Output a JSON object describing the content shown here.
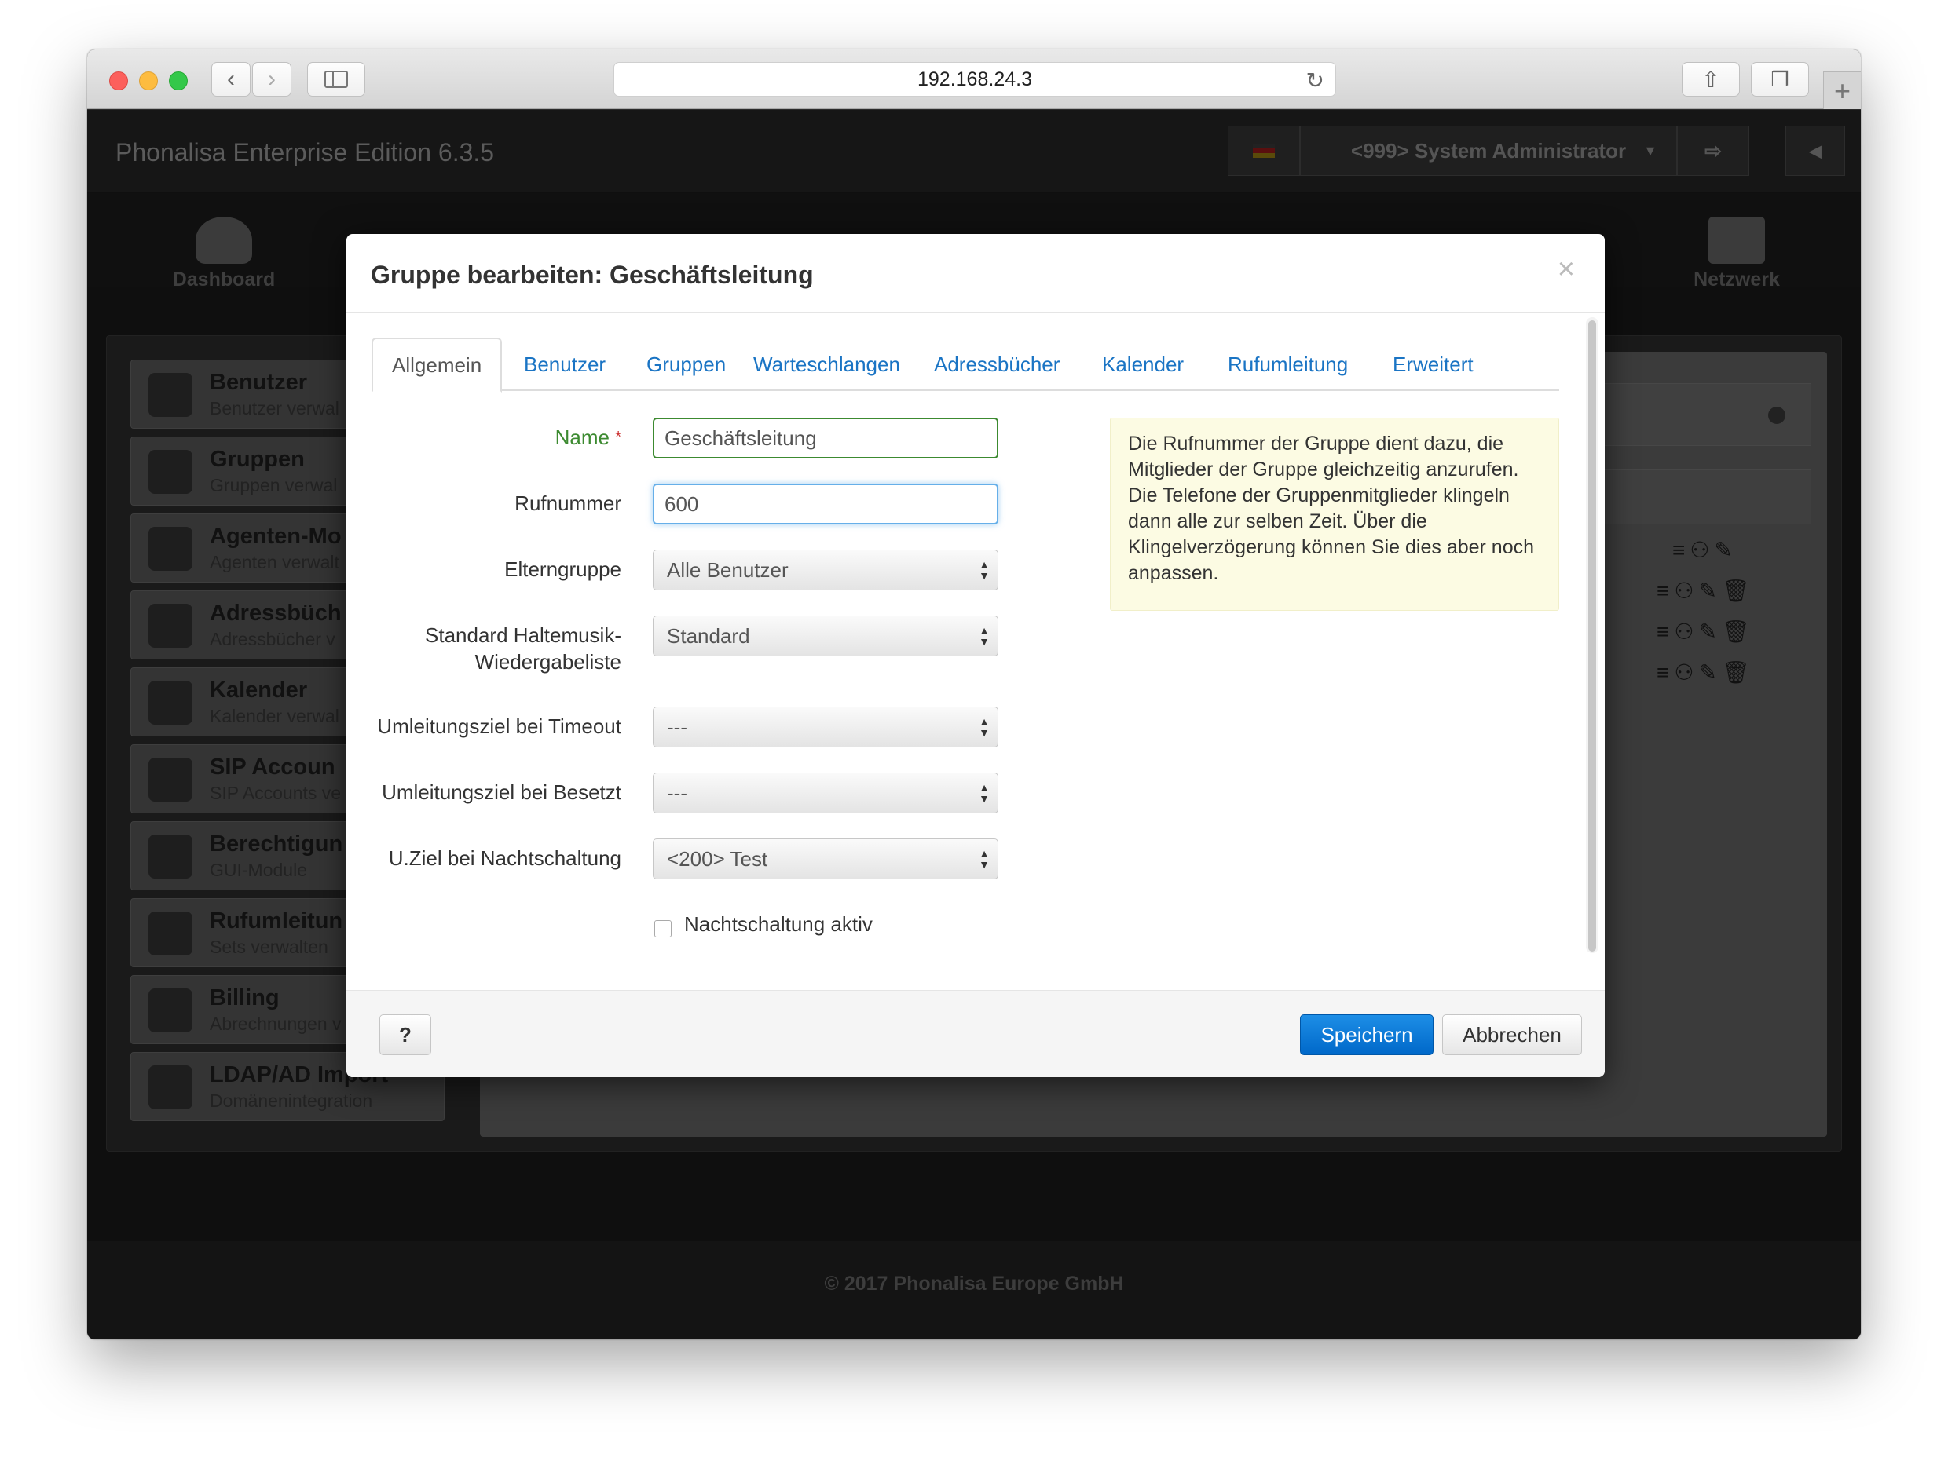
{
  "browser": {
    "url": "192.168.24.3",
    "back_icon": "chevron-left-icon",
    "forward_icon": "chevron-right-icon"
  },
  "app": {
    "brand": "Phonalisa Enterprise Edition 6.3.5",
    "user_menu": "<999> System Administrator",
    "nav": {
      "dashboard": "Dashboard",
      "netzwerk": "Netzwerk"
    },
    "sidebar": [
      {
        "title": "Benutzer",
        "subtitle": "Benutzer verwal"
      },
      {
        "title": "Gruppen",
        "subtitle": "Gruppen verwal"
      },
      {
        "title": "Agenten-Mo",
        "subtitle": "Agenten verwalt"
      },
      {
        "title": "Adressbüch",
        "subtitle": "Adressbücher v"
      },
      {
        "title": "Kalender",
        "subtitle": "Kalender verwal"
      },
      {
        "title": "SIP Accoun",
        "subtitle": "SIP Accounts ve"
      },
      {
        "title": "Berechtigun",
        "subtitle": "GUI-Module"
      },
      {
        "title": "Rufumleitun",
        "subtitle": "Sets verwalten"
      },
      {
        "title": "Billing",
        "subtitle": "Abrechnungen v"
      },
      {
        "title": "LDAP/AD Import",
        "subtitle": "Domänenintegration"
      }
    ],
    "footer": "© 2017 Phonalisa Europe GmbH"
  },
  "modal": {
    "title": "Gruppe bearbeiten: Geschäftsleitung",
    "close": "×",
    "tabs": [
      "Allgemein",
      "Benutzer",
      "Gruppen",
      "Warteschlangen",
      "Adressbücher",
      "Kalender",
      "Rufumleitung",
      "Erweitert"
    ],
    "fields": {
      "name_label": "Name",
      "name_required": "*",
      "name_value": "Geschäftsleitung",
      "rufnummer_label": "Rufnummer",
      "rufnummer_value": "600",
      "elterngruppe_label": "Elterngruppe",
      "elterngruppe_value": "Alle Benutzer",
      "haltemusik_label_1": "Standard Haltemusik-",
      "haltemusik_label_2": "Wiedergabeliste",
      "haltemusik_value": "Standard",
      "timeout_label": "Umleitungsziel bei Timeout",
      "timeout_value": "---",
      "besetzt_label": "Umleitungsziel bei Besetzt",
      "besetzt_value": "---",
      "nacht_label": "U.Ziel bei Nachtschaltung",
      "nacht_value": "<200> Test",
      "nacht_checkbox_label": "Nachtschaltung aktiv"
    },
    "info": "Die Rufnummer der Gruppe dient dazu, die Mitglieder der Gruppe gleichzeitig anzurufen. Die Telefone der Gruppenmitglieder klingeln dann alle zur selben Zeit. Über die Klingelverzögerung können Sie dies aber noch anpassen.",
    "buttons": {
      "help": "?",
      "save": "Speichern",
      "cancel": "Abbrechen"
    }
  },
  "colors": {
    "primary": "#0068c9",
    "link": "#1a74c4",
    "valid": "#3c8a30",
    "info_bg": "#fcfbe3"
  }
}
